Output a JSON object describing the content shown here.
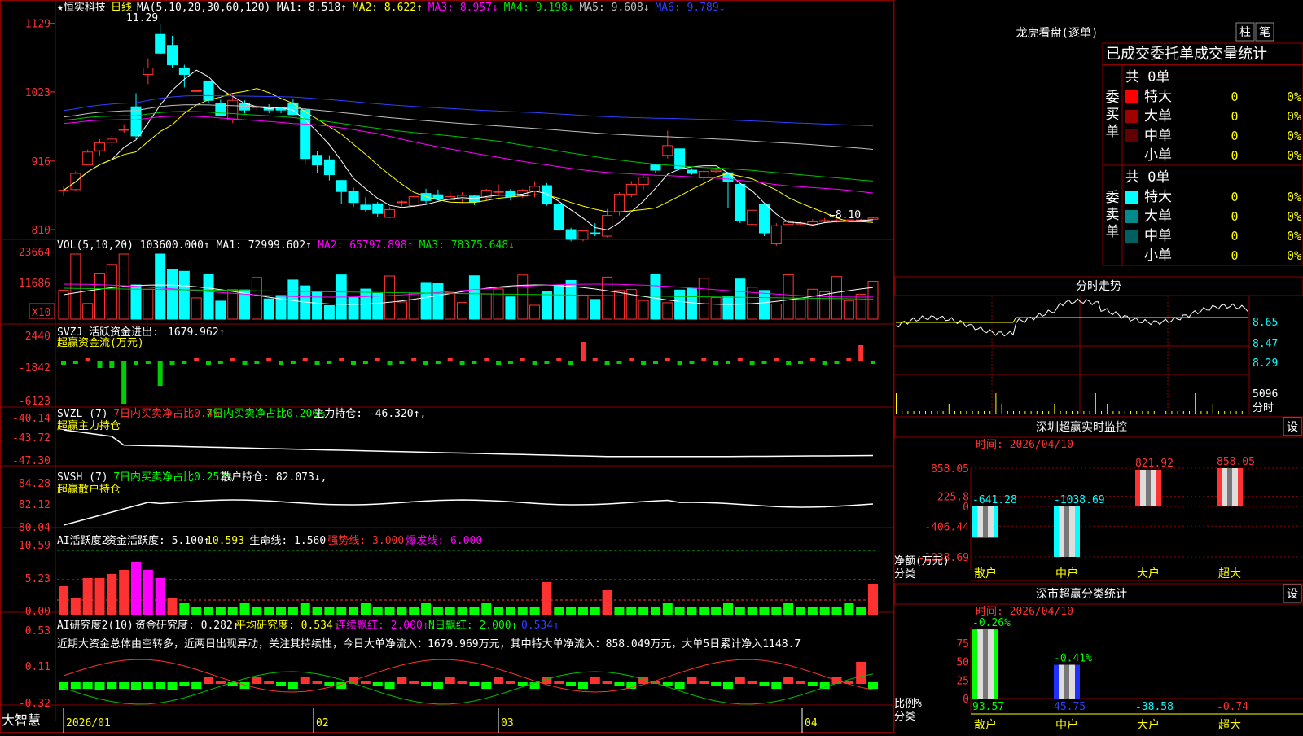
{
  "app": {
    "name": "大智慧"
  },
  "stock": {
    "name": "★恒实科技",
    "period": "日线"
  },
  "colors": {
    "up": "#ff3232",
    "down": "#00ffff",
    "grid": "#8b0000",
    "axis": "#b00000",
    "ma1": "#ffffff",
    "ma2": "#ffff00",
    "ma3": "#ff00ff",
    "ma4": "#00c000",
    "ma5": "#c0c0c0",
    "ma6": "#3040ff"
  },
  "panels": {
    "price": {
      "title": "MA(5,10,20,30,60,120)",
      "items": [
        {
          "label": "MA1:",
          "value": "8.518↑",
          "color": "#ffffff"
        },
        {
          "label": "MA2:",
          "value": "8.622↑",
          "color": "#ffff00"
        },
        {
          "label": "MA3:",
          "value": "8.957↓",
          "color": "#ff00ff"
        },
        {
          "label": "MA4:",
          "value": "9.198↓",
          "color": "#00e000"
        },
        {
          "label": "MA5:",
          "value": "9.608↓",
          "color": "#c0c0c0"
        },
        {
          "label": "MA6:",
          "value": "9.789↓",
          "color": "#3040ff"
        }
      ],
      "yticks": [
        "1129",
        "1023",
        "916",
        "810"
      ],
      "high_label": "11.29",
      "low_label": "←8.10"
    },
    "vol": {
      "title": "VOL(5,10,20)",
      "value": "103600.000↑",
      "items": [
        {
          "label": "MA1:",
          "value": "72999.602↑",
          "color": "#ffffff"
        },
        {
          "label": "MA2:",
          "value": "65797.898↑",
          "color": "#ff00ff"
        },
        {
          "label": "MA3:",
          "value": "78375.648↓",
          "color": "#00e000"
        }
      ],
      "yticks": [
        "23664",
        "11686"
      ],
      "unit": "X10"
    },
    "svzj": {
      "title": "SVZJ",
      "label": "活跃资金进出:",
      "value": "1679.962↑",
      "sub": "超赢资金流(万元)",
      "yticks": [
        "2440",
        "-1842",
        "-6123"
      ]
    },
    "svzl": {
      "title": "SVZL (7)",
      "t1": "7日内买卖净占比0.4%",
      "t2": "7日内买卖净占比0.206%",
      "t3": "主力持仓:",
      "v3": "-46.320↑,",
      "sub": "超赢主力持仓",
      "yticks": [
        "-40.14",
        "-43.72",
        "-47.30"
      ]
    },
    "svsh": {
      "title": "SVSH (7)",
      "t1": "7日内买卖净占比0.252%",
      "t2": "散户持仓:",
      "v2": "82.073↓,",
      "sub": "超赢散户持仓",
      "yticks": [
        "84.28",
        "82.12",
        "80.04"
      ]
    },
    "ai1": {
      "title": "AI活跃度2",
      "l1": "资金活跃度:",
      "v1": "5.100↑",
      "v2": "10.593",
      "l3": "生命线:",
      "v3": "1.560",
      "l4": "强势线:",
      "v4": "3.000",
      "l5": "爆发线:",
      "v5": "6.000",
      "yticks": [
        "10.59",
        "5.23",
        "0.00"
      ]
    },
    "ai2": {
      "title": "AI研究度2(10)",
      "l1": "资金研究度:",
      "v1": "0.282↑",
      "l2": "平均研究度:",
      "v2": "0.534↑",
      "l3": "连续飘红:",
      "v3": "2.000↑",
      "l4": "N日飘红:",
      "v4": "2.000↑",
      "v5": "0.534↑",
      "text": "近期大资金总体由空转多，近两日出现异动，关注其持续性，今日大单净流入：1679.969万元，其中特大单净流入：858.049万元，大单5日累计净入1148.7",
      "yticks": [
        "0.53",
        "0.11",
        "-0.32"
      ]
    }
  },
  "xaxis": [
    "2026/01",
    "02",
    "03",
    "04"
  ],
  "chart_data": {
    "type": "candlestick",
    "ylim": [
      8.0,
      11.4
    ],
    "candles": [
      [
        8.7,
        8.71,
        8.78,
        8.62
      ],
      [
        8.72,
        8.97,
        9.0,
        8.7
      ],
      [
        9.1,
        9.3,
        9.34,
        9.1
      ],
      [
        9.32,
        9.44,
        9.5,
        9.25
      ],
      [
        9.45,
        9.5,
        9.55,
        9.38
      ],
      [
        9.65,
        9.65,
        9.73,
        9.6
      ],
      [
        10.0,
        9.55,
        10.21,
        9.5
      ],
      [
        10.5,
        10.6,
        10.75,
        10.35
      ],
      [
        11.12,
        10.83,
        11.29,
        10.81
      ],
      [
        10.95,
        10.65,
        11.1,
        10.6
      ],
      [
        10.6,
        10.5,
        10.65,
        10.3
      ],
      [
        10.25,
        10.25,
        10.25,
        10.25
      ],
      [
        10.4,
        10.1,
        10.4,
        10.06
      ],
      [
        10.05,
        9.86,
        10.11,
        9.85
      ],
      [
        9.8,
        10.1,
        10.2,
        9.75
      ],
      [
        10.05,
        9.95,
        10.1,
        9.9
      ],
      [
        10.0,
        10.0,
        10.04,
        9.94
      ],
      [
        9.99,
        9.95,
        10.04,
        9.9
      ],
      [
        9.98,
        9.95,
        10.0,
        9.9
      ],
      [
        10.06,
        9.88,
        10.12,
        9.87
      ],
      [
        9.95,
        9.2,
        9.95,
        9.12
      ],
      [
        9.25,
        9.1,
        9.32,
        8.98
      ],
      [
        9.18,
        8.95,
        9.25,
        8.86
      ],
      [
        8.86,
        8.69,
        8.87,
        8.5
      ],
      [
        8.69,
        8.52,
        8.75,
        8.45
      ],
      [
        8.48,
        8.41,
        8.6,
        8.38
      ],
      [
        8.5,
        8.35,
        8.53,
        8.3
      ],
      [
        8.29,
        8.41,
        8.45,
        8.28
      ],
      [
        8.53,
        8.53,
        8.55,
        8.46
      ],
      [
        8.47,
        8.61,
        8.62,
        8.45
      ],
      [
        8.66,
        8.55,
        8.73,
        8.5
      ],
      [
        8.64,
        8.58,
        8.72,
        8.55
      ],
      [
        8.56,
        8.61,
        8.7,
        8.55
      ],
      [
        8.57,
        8.63,
        8.68,
        8.52
      ],
      [
        8.62,
        8.53,
        8.64,
        8.48
      ],
      [
        8.6,
        8.71,
        8.73,
        8.55
      ],
      [
        8.68,
        8.69,
        8.8,
        8.62
      ],
      [
        8.7,
        8.61,
        8.73,
        8.55
      ],
      [
        8.62,
        8.71,
        8.73,
        8.59
      ],
      [
        8.7,
        8.77,
        8.85,
        8.6
      ],
      [
        8.78,
        8.5,
        8.82,
        8.47
      ],
      [
        8.49,
        8.1,
        8.52,
        8.08
      ],
      [
        8.1,
        7.95,
        8.13,
        7.92
      ],
      [
        7.95,
        8.08,
        8.1,
        7.92
      ],
      [
        8.05,
        8.03,
        8.2,
        8.0
      ],
      [
        8.0,
        8.32,
        8.42,
        7.98
      ],
      [
        8.38,
        8.65,
        8.68,
        8.32
      ],
      [
        8.65,
        8.8,
        8.85,
        8.6
      ],
      [
        8.8,
        8.91,
        8.95,
        8.72
      ],
      [
        9.1,
        9.02,
        9.12,
        8.98
      ],
      [
        9.25,
        9.4,
        9.63,
        9.2
      ],
      [
        9.35,
        9.05,
        9.35,
        9.05
      ],
      [
        9.02,
        8.97,
        9.05,
        8.95
      ],
      [
        8.9,
        9.0,
        9.02,
        8.85
      ],
      [
        9.0,
        9.02,
        9.05,
        8.98
      ],
      [
        8.98,
        8.85,
        8.99,
        8.43
      ],
      [
        8.8,
        8.24,
        8.8,
        8.2
      ],
      [
        8.18,
        8.4,
        8.42,
        8.15
      ],
      [
        8.49,
        8.05,
        8.5,
        8.0
      ],
      [
        7.88,
        8.16,
        8.2,
        7.85
      ],
      [
        8.18,
        8.22,
        8.25,
        8.18
      ],
      [
        8.2,
        8.2,
        8.24,
        8.16
      ],
      [
        8.18,
        8.22,
        8.26,
        8.16
      ],
      [
        8.23,
        8.24,
        8.28,
        8.2
      ],
      [
        8.24,
        8.24,
        8.26,
        8.21
      ],
      [
        8.24,
        8.25,
        8.26,
        8.22
      ],
      [
        8.25,
        8.25,
        8.27,
        8.23
      ],
      [
        8.26,
        8.28,
        8.3,
        8.25
      ]
    ]
  },
  "right": {
    "top_title": "龙虎看盘(逐单)",
    "btn1": "柱",
    "btn2": "笔",
    "stats_title": "已成交委托单成交量统计",
    "buy_label": "委买单",
    "sell_label": "委卖单",
    "buy_total": "共 0单",
    "sell_total": "共 0单",
    "buy_rows": [
      {
        "name": "特大",
        "count": "0",
        "pct": "0%",
        "color": "#ff0000"
      },
      {
        "name": "大单",
        "count": "0",
        "pct": "0%",
        "color": "#a00000"
      },
      {
        "name": "中单",
        "count": "0",
        "pct": "0%",
        "color": "#600000"
      },
      {
        "name": "小单",
        "count": "0",
        "pct": "0%",
        "color": ""
      }
    ],
    "sell_rows": [
      {
        "name": "特大",
        "count": "0",
        "pct": "0%",
        "color": "#00ffff"
      },
      {
        "name": "大单",
        "count": "0",
        "pct": "0%",
        "color": "#008b8b"
      },
      {
        "name": "中单",
        "count": "0",
        "pct": "0%",
        "color": "#005f5f"
      },
      {
        "name": "小单",
        "count": "0",
        "pct": "0%",
        "color": ""
      }
    ],
    "intraday_title": "分时走势",
    "intraday_yticks": [
      "8.65",
      "8.47",
      "8.29",
      "5096"
    ],
    "intraday_sublabel": "分时",
    "sz_title": "深圳超赢实时监控",
    "sz_btn": "设",
    "sz_time": "时间: 2026/04/10",
    "sz_ylabel": "净额(万元)",
    "sz_xlabel": "分类",
    "sz_yticks": [
      "858.05",
      "225.8",
      "0",
      "-406.44",
      "-1038.69"
    ],
    "sz_cats": [
      "散户",
      "中户",
      "大户",
      "超大"
    ],
    "sz_vals": [
      -641.28,
      -1038.69,
      821.92,
      858.05
    ],
    "sz_val_labels": [
      "-641.28",
      "-1038.69",
      "821.92",
      "858.05"
    ],
    "sh_title": "深市超赢分类统计",
    "sh_btn": "设",
    "sh_time": "时间: 2026/04/10",
    "sh_ylabel": "比例%",
    "sh_xlabel": "分类",
    "sh_yticks": [
      "75",
      "50",
      "25",
      "0"
    ],
    "sh_cats": [
      "散户",
      "中户",
      "大户",
      "超大"
    ],
    "sh_vals": [
      93.57,
      45.75,
      -38.58,
      -0.74
    ],
    "sh_val_labels": [
      "93.57",
      "45.75",
      "-38.58",
      "-0.74"
    ],
    "sh_top_labels": [
      "-0.26%",
      "-0.41%"
    ]
  }
}
